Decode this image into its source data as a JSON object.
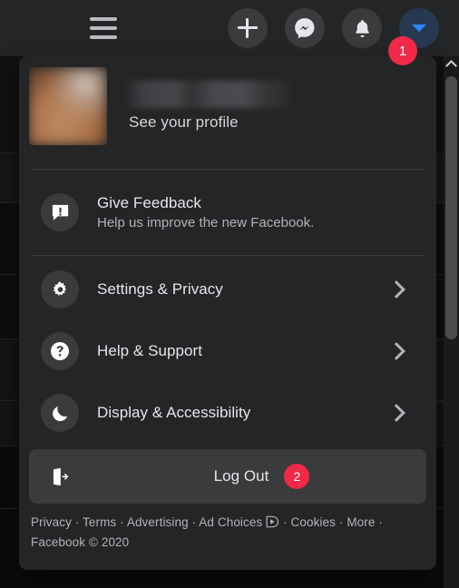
{
  "header": {
    "menu_icon": "hamburger-menu-icon",
    "buttons": [
      {
        "name": "create-button",
        "icon": "plus-icon",
        "label": "Create"
      },
      {
        "name": "messenger-button",
        "icon": "messenger-icon",
        "label": "Messenger"
      },
      {
        "name": "notifications-button",
        "icon": "bell-icon",
        "label": "Notifications"
      },
      {
        "name": "account-button",
        "icon": "chevron-down-icon",
        "label": "Account"
      }
    ],
    "account_badge": "1",
    "badge_color": "#f02849",
    "account_button_color": "#263951"
  },
  "menu": {
    "profile": {
      "name_redacted": "",
      "see_profile": "See your profile",
      "avatar": "user-avatar-blurred"
    },
    "feedback": {
      "title": "Give Feedback",
      "subtitle": "Help us improve the new Facebook.",
      "icon": "feedback-speech-bubble-icon"
    },
    "items": [
      {
        "title": "Settings & Privacy",
        "icon": "gear-icon",
        "has_chevron": true
      },
      {
        "title": "Help & Support",
        "icon": "question-mark-icon",
        "has_chevron": true
      },
      {
        "title": "Display & Accessibility",
        "icon": "moon-icon",
        "has_chevron": true
      }
    ],
    "logout": {
      "title": "Log Out",
      "icon": "logout-door-arrow-icon",
      "badge": "2"
    },
    "footer": {
      "privacy": "Privacy",
      "terms": "Terms",
      "advertising": "Advertising",
      "ad_choices": "Ad Choices",
      "ad_choices_icon": "adchoices-triangle-icon",
      "cookies": "Cookies",
      "more": "More",
      "copyright": "Facebook © 2020",
      "separator": " · "
    }
  },
  "scrollbar": {
    "up_arrow": "scroll-up-arrow-icon"
  }
}
